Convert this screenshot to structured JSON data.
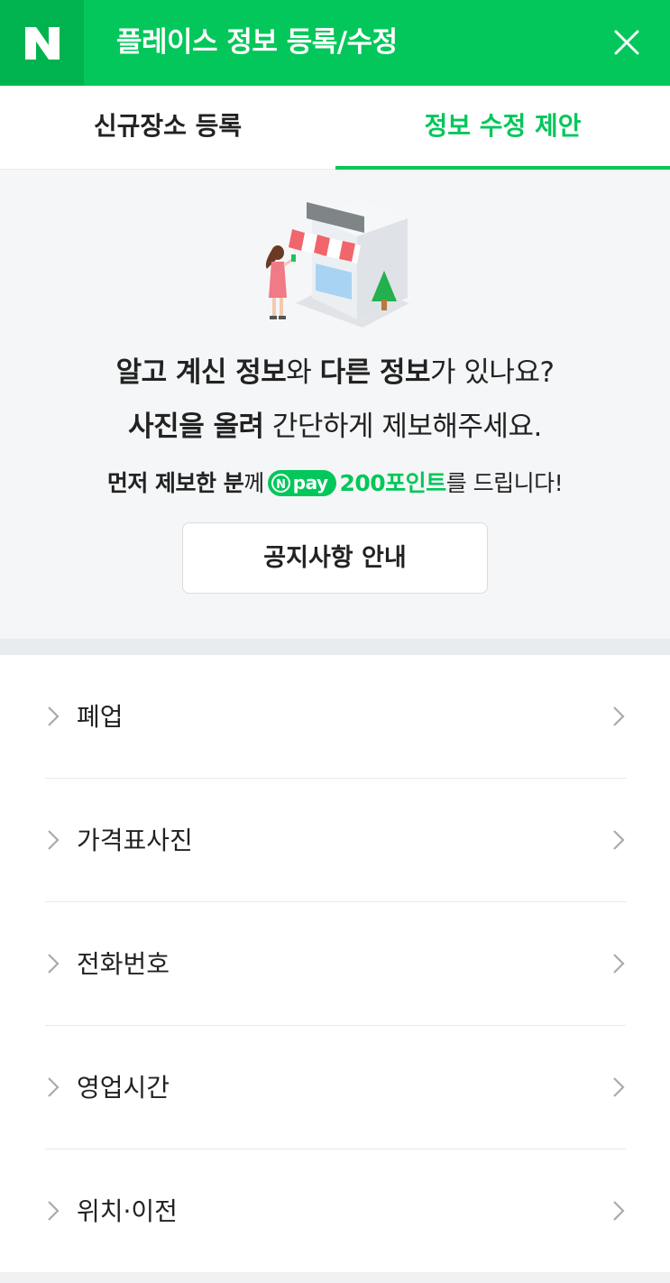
{
  "header": {
    "logo": "N",
    "title": "플레이스 정보 등록/수정",
    "close_icon": "close-icon",
    "brand_color": "#03c75a"
  },
  "tabs": [
    {
      "label": "신규장소 등록",
      "active": false
    },
    {
      "label": "정보 수정 제안",
      "active": true
    }
  ],
  "banner": {
    "line1": {
      "b1": "알고 계신 정보",
      "t1": "와 ",
      "b2": "다른 정보",
      "t2": "가 있나요?"
    },
    "line2": {
      "b1": "사진을 올려",
      "t1": " 간단하게 제보해주세요."
    },
    "line3": {
      "b1": "먼저 제보한 분",
      "t1": "께",
      "badge_n": "N",
      "badge_text": "pay",
      "points": "200포인트",
      "t2": "를 드립니다!"
    },
    "notice_button": "공지사항 안내"
  },
  "list": [
    {
      "label": "폐업"
    },
    {
      "label": "가격표사진"
    },
    {
      "label": "전화번호"
    },
    {
      "label": "영업시간"
    },
    {
      "label": "위치·이전"
    }
  ]
}
